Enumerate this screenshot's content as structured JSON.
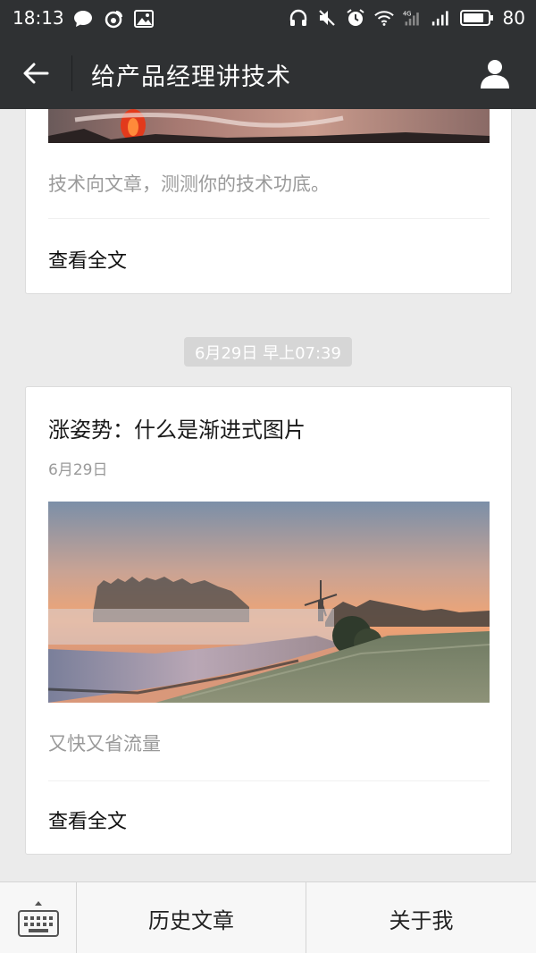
{
  "status_bar": {
    "time": "18:13",
    "battery": "80",
    "left_icons": [
      "chat-bubble-icon",
      "weibo-icon",
      "image-icon"
    ],
    "right_icons": [
      "headphones-icon",
      "mute-icon",
      "alarm-icon",
      "wifi-icon",
      "signal-4g-icon",
      "signal-icon",
      "battery-icon"
    ]
  },
  "header": {
    "title": "给产品经理讲技术",
    "back_icon": "back-arrow-icon",
    "profile_icon": "person-icon"
  },
  "feed": {
    "prev_card": {
      "summary": "技术向文章，测测你的技术功底。",
      "read_more": "查看全文"
    },
    "timestamp": "6月29日 早上07:39",
    "article": {
      "title": "涨姿势：什么是渐进式图片",
      "date": "6月29日",
      "summary": "又快又省流量",
      "read_more": "查看全文"
    }
  },
  "bottom_menu": {
    "keyboard_icon": "keyboard-icon",
    "items": [
      {
        "label": "历史文章"
      },
      {
        "label": "关于我"
      }
    ]
  },
  "colors": {
    "header_bg": "#2f3133",
    "page_bg": "#ebebeb",
    "summary_text": "#9a9a9a",
    "timestamp_bg": "#d6d6d6"
  }
}
